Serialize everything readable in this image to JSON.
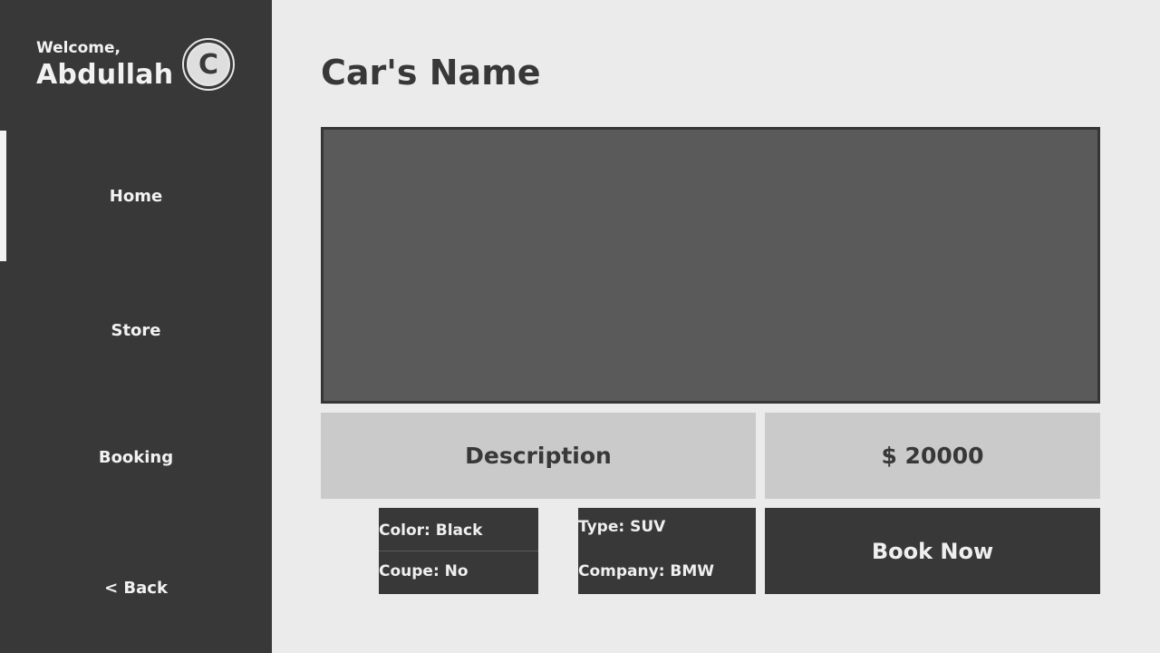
{
  "sidebar": {
    "welcome_label": "Welcome,",
    "user_name": "Abdullah",
    "avatar_letter": "C",
    "nav": {
      "home": "Home",
      "store": "Store",
      "booking": "Booking",
      "back": "< Back"
    },
    "active_item": "Home"
  },
  "main": {
    "title": "Car's Name",
    "description_label": "Description",
    "price": "$ 20000",
    "specs": {
      "color": "Color: Black",
      "coupe": "Coupe: No",
      "type": "Type: SUV",
      "company": "Company: BMW"
    },
    "book_label": "Book Now"
  },
  "colors": {
    "sidebar_bg": "#383838",
    "page_bg": "#ebebeb",
    "image_placeholder": "#5a5a5a",
    "info_box_bg": "#cacaca",
    "text_light": "#f2f2f2",
    "text_dark": "#383838"
  }
}
